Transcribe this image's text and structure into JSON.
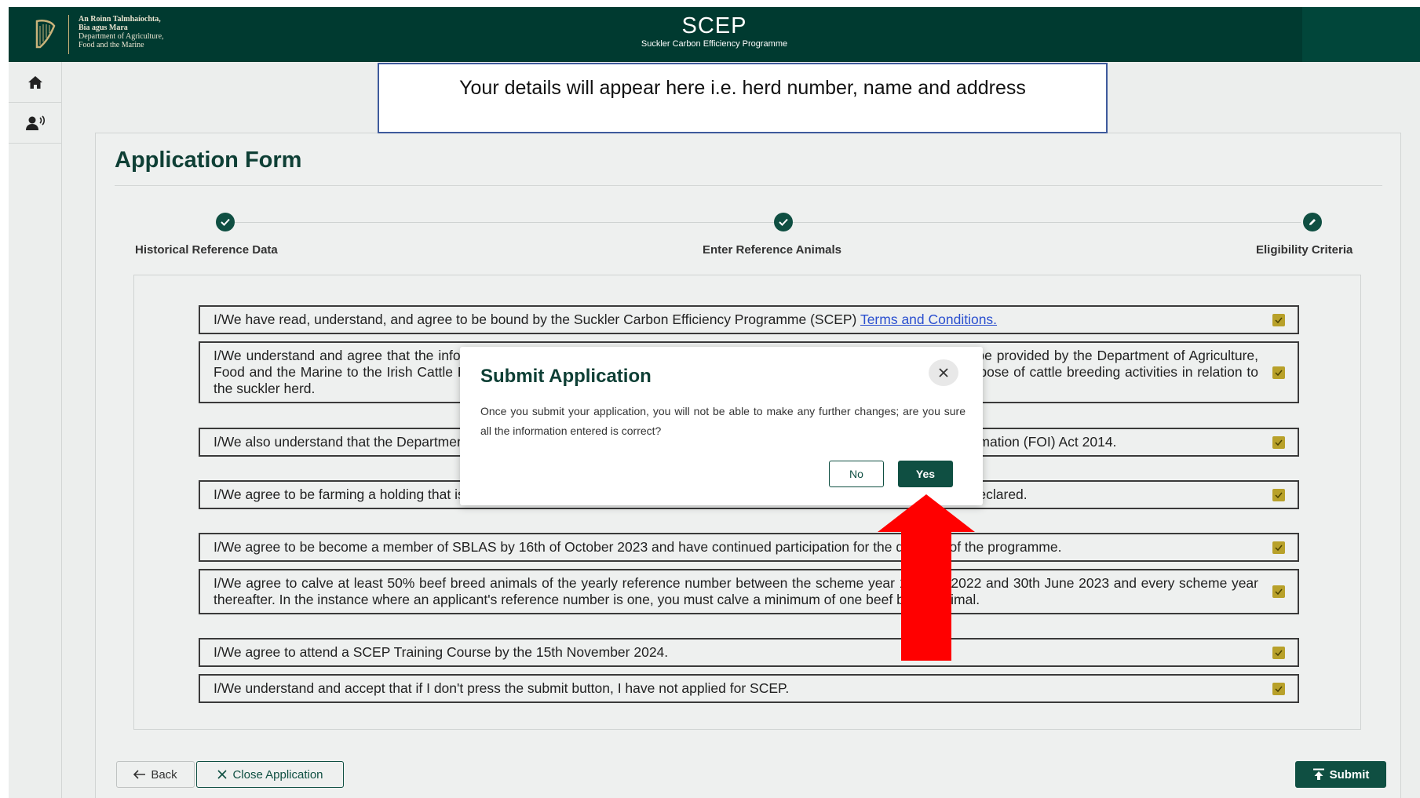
{
  "header": {
    "dept_lines": [
      "An Roinn Talmhaíochta,",
      "Bia agus Mara",
      "Department of Agriculture,",
      "Food and the Marine"
    ],
    "app_title": "SCEP",
    "app_subtitle": "Suckler Carbon Efficiency Programme",
    "logo_icon": "harp-icon"
  },
  "sidebar": {
    "items": [
      {
        "icon": "home-icon"
      },
      {
        "icon": "voice-support-icon"
      }
    ]
  },
  "details_banner": "Your details will appear here i.e. herd number, name and address",
  "form": {
    "title": "Application Form",
    "steps": [
      {
        "label": "Historical Reference Data",
        "state": "complete"
      },
      {
        "label": "Enter Reference Animals",
        "state": "complete"
      },
      {
        "label": "Eligibility Criteria",
        "state": "editing"
      }
    ],
    "criteria": [
      {
        "text": "I/We have read, understand, and agree to be bound by the Suckler Carbon Efficiency Programme (SCEP) ",
        "link": "Terms and Conditions.",
        "checked": true
      },
      {
        "text": "I/We understand and agree that the information contained on this application, along with any supporting documentation will be provided by the Department of Agriculture, Food and the Marine to the Irish Cattle Breeding Federation (ICBF). It will be stored and used by the Department for the purpose of cattle breeding activities in relation to the suckler herd.",
        "checked": true
      },
      {
        "text": "I/We also understand that the Department may be required to release information under the provisions of the Freedom of Information (FOI) Act 2014.",
        "checked": true
      },
      {
        "text": "I/We agree to be farming a holding that is registered with the Department on a yearly basis and on which all land parcels are declared.",
        "checked": true
      },
      {
        "text": "I/We agree to be become a member of SBLAS by 16th of October 2023 and have continued participation for the duration of the programme.",
        "checked": true
      },
      {
        "text": "I/We agree to calve at least 50% beef breed animals of the yearly reference number between the scheme year 1st July 2022 and 30th June 2023 and every scheme year thereafter. In the instance where an applicant's reference number is one, you must calve a minimum of one beef breed animal.",
        "checked": true
      },
      {
        "text": "I/We agree to attend a SCEP Training Course by the 15th November 2024.",
        "checked": true
      },
      {
        "text": "I/We understand and accept that if I don't press the submit button, I have not applied for SCEP.",
        "checked": true
      }
    ],
    "buttons": {
      "back": "Back",
      "close": "Close Application",
      "submit": "Submit"
    }
  },
  "modal": {
    "title": "Submit Application",
    "body": "Once you submit your application, you will not be able to make any further changes; are you sure all the information entered is correct?",
    "no_label": "No",
    "yes_label": "Yes"
  },
  "colors": {
    "brand_dark": "#003a30",
    "primary": "#0f4f42",
    "checkbox": "#b8a12a",
    "annotation_arrow": "#ff0000",
    "link": "#2a4fcf"
  }
}
